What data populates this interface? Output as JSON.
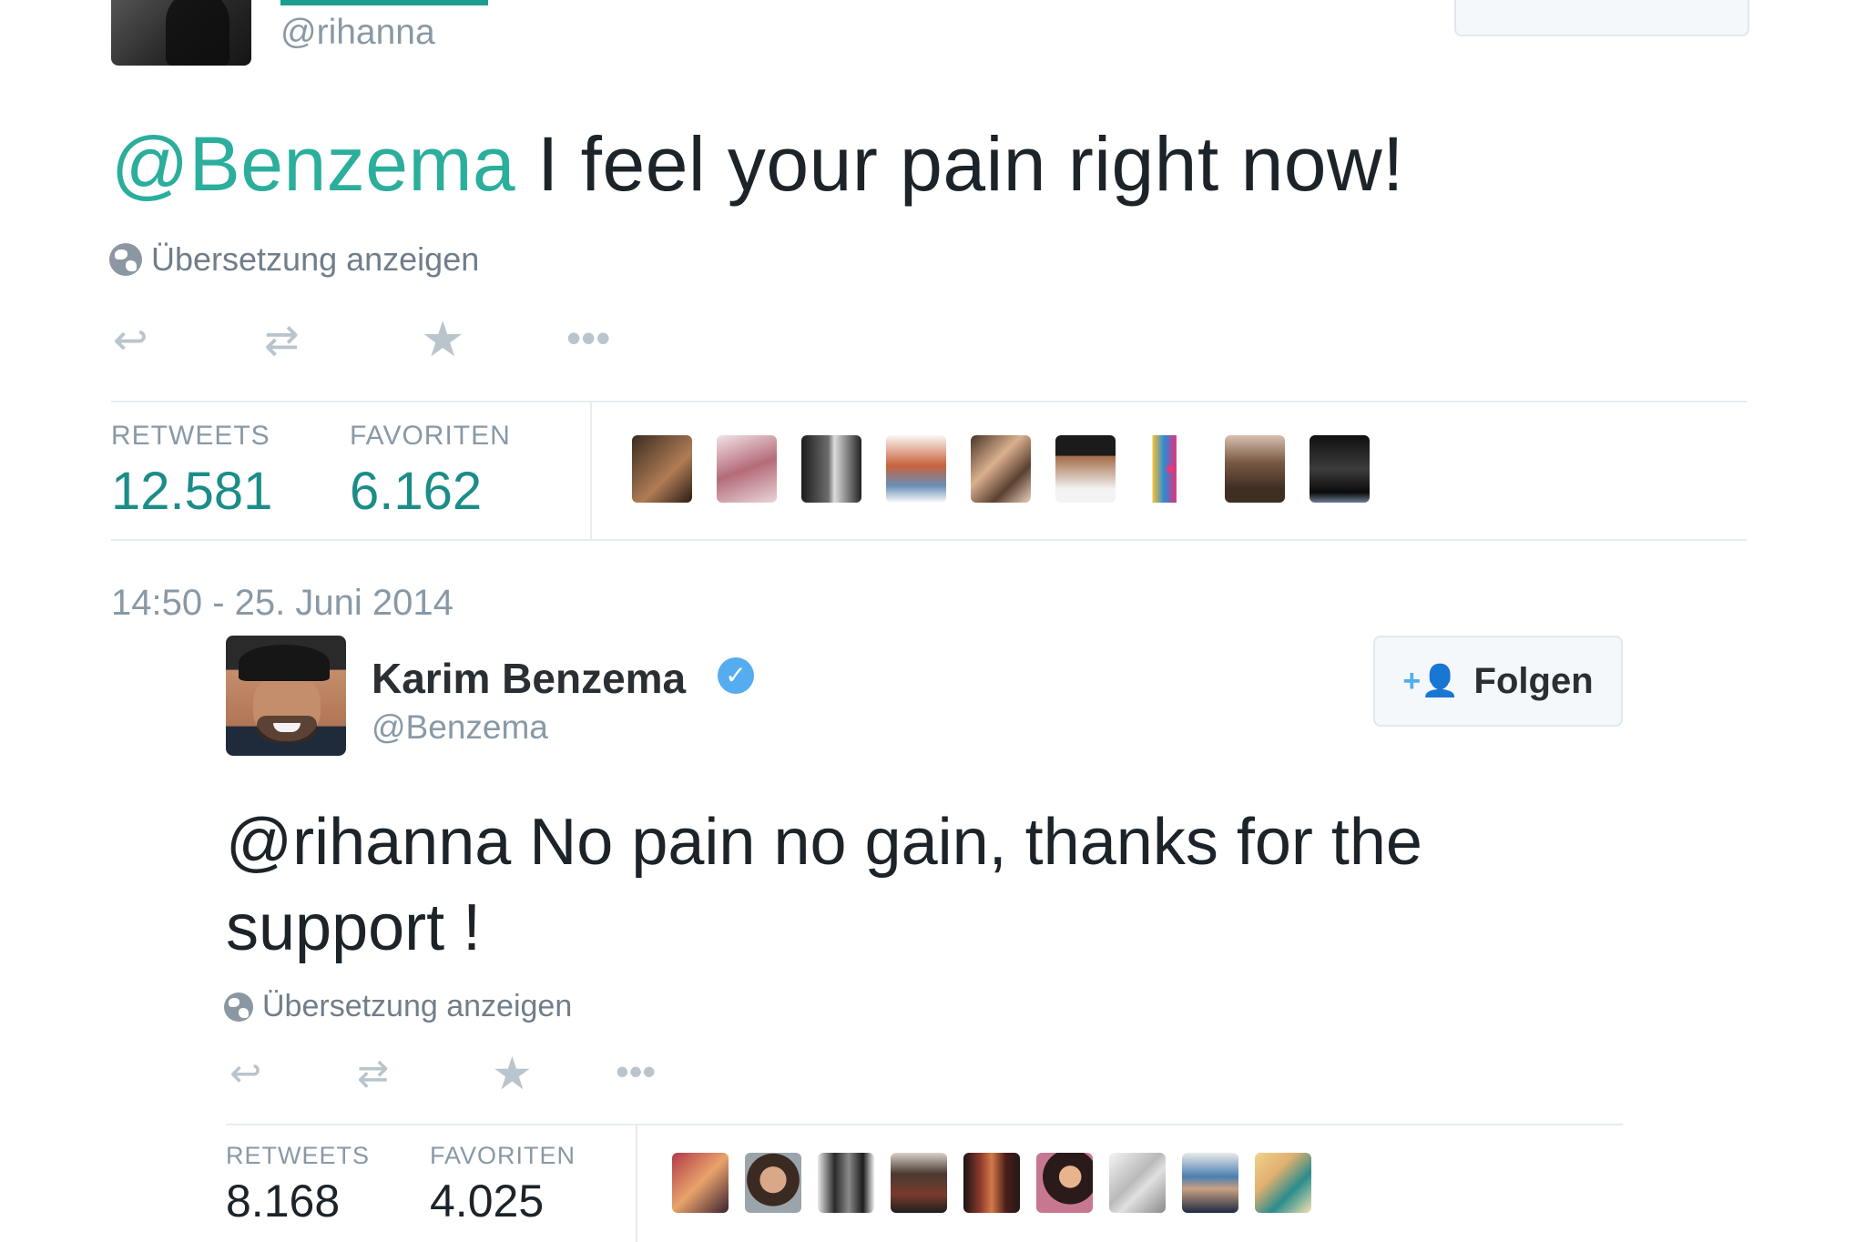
{
  "tweet1": {
    "handle": "@rihanna",
    "text_mention": "@Benzema",
    "text_body": " I feel your pain right now!",
    "translate_label": "Übersetzung anzeigen",
    "stats": {
      "retweets_label": "RETWEETS",
      "retweets_value": "12.581",
      "favorites_label": "FAVORITEN",
      "favorites_value": "6.162"
    },
    "timestamp": "14:50 - 25. Juni 2014"
  },
  "tweet2": {
    "name": "Karim Benzema",
    "handle": "@Benzema",
    "follow_label": "Folgen",
    "text_mention": "@rihanna",
    "text_body": " No pain no gain, thanks for the support !",
    "translate_label": "Übersetzung anzeigen",
    "stats": {
      "retweets_label": "RETWEETS",
      "retweets_value": "8.168",
      "favorites_label": "FAVORITEN",
      "favorites_value": "4.025"
    }
  },
  "icons": {
    "reply": "reply-icon",
    "retweet": "retweet-icon",
    "favorite": "star-icon",
    "more": "more-icon",
    "globe": "globe-icon",
    "verified": "verified-badge-icon",
    "follow": "add-user-icon"
  },
  "colors": {
    "mention_teal": "#2bae9c",
    "stat_teal": "#1b8d88",
    "verified_blue": "#55acee",
    "muted_gray": "#8899a6",
    "action_gray": "#bac4cc"
  }
}
